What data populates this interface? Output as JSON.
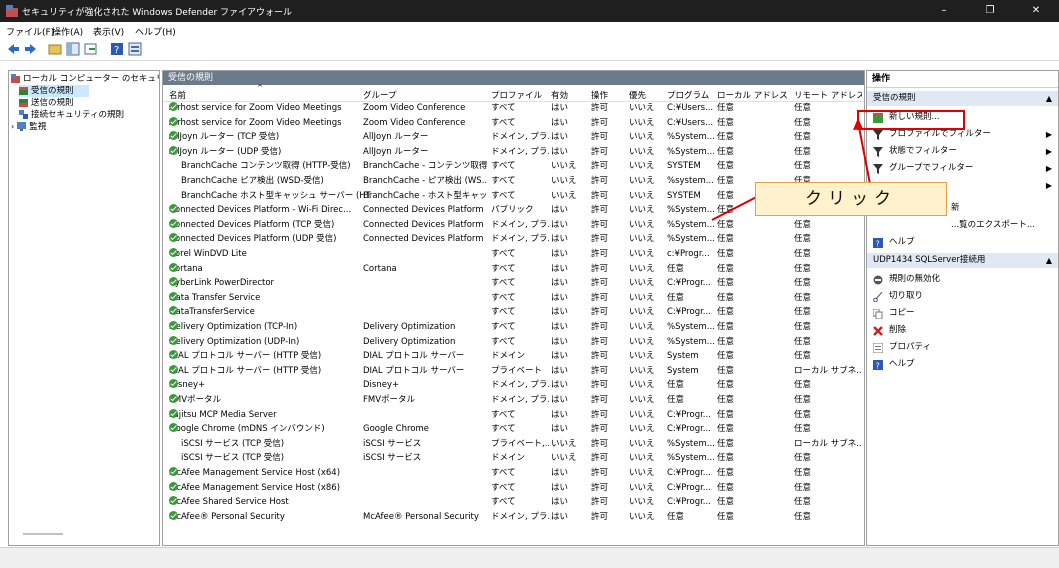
{
  "window": {
    "title": "セキュリティが強化された Windows Defender ファイアウォール",
    "min": "–",
    "restore": "❐",
    "close": "✕"
  },
  "menu": [
    "ファイル(F)",
    "操作(A)",
    "表示(V)",
    "ヘルプ(H)"
  ],
  "tree": {
    "root": "ローカル コンピューター のセキュリティ",
    "items": [
      "受信の規則",
      "送信の規則",
      "接続セキュリティの規則",
      "監視"
    ]
  },
  "middle": {
    "header": "受信の規則",
    "columns": [
      "名前",
      "グループ",
      "プロファイル",
      "有効",
      "操作",
      "優先",
      "プログラム",
      "ローカル アドレス",
      "リモート アドレス"
    ],
    "rows": [
      {
        "icon": true,
        "name": "Airhost service for Zoom Video Meetings",
        "group": "Zoom Video Conference",
        "profile": "すべて",
        "enabled": "はい",
        "action": "許可",
        "override": "いいえ",
        "program": "C:¥Users...",
        "local": "任意",
        "remote": "任意"
      },
      {
        "icon": true,
        "name": "Airhost service for Zoom Video Meetings",
        "group": "Zoom Video Conference",
        "profile": "すべて",
        "enabled": "はい",
        "action": "許可",
        "override": "いいえ",
        "program": "C:¥Users...",
        "local": "任意",
        "remote": "任意"
      },
      {
        "icon": true,
        "name": "AllJoyn ルーター (TCP 受信)",
        "group": "AllJoyn ルーター",
        "profile": "ドメイン, プラ...",
        "enabled": "はい",
        "action": "許可",
        "override": "いいえ",
        "program": "%System...",
        "local": "任意",
        "remote": "任意"
      },
      {
        "icon": true,
        "name": "AllJoyn ルーター (UDP 受信)",
        "group": "AllJoyn ルーター",
        "profile": "ドメイン, プラ...",
        "enabled": "はい",
        "action": "許可",
        "override": "いいえ",
        "program": "%System...",
        "local": "任意",
        "remote": "任意"
      },
      {
        "icon": false,
        "name": "BranchCache コンテンツ取得 (HTTP-受信)",
        "group": "BranchCache - コンテンツ取得...",
        "profile": "すべて",
        "enabled": "いいえ",
        "action": "許可",
        "override": "いいえ",
        "program": "SYSTEM",
        "local": "任意",
        "remote": "任意"
      },
      {
        "icon": false,
        "name": "BranchCache ピア検出 (WSD-受信)",
        "group": "BranchCache - ピア検出 (WS...",
        "profile": "すべて",
        "enabled": "いいえ",
        "action": "許可",
        "override": "いいえ",
        "program": "%system...",
        "local": "任意",
        "remote": "任意"
      },
      {
        "icon": false,
        "name": "BranchCache ホスト型キャッシュ サーバー (HT...",
        "group": "BranchCache - ホスト型キャッ...",
        "profile": "すべて",
        "enabled": "いいえ",
        "action": "許可",
        "override": "いいえ",
        "program": "SYSTEM",
        "local": "任意",
        "remote": "任意"
      },
      {
        "icon": true,
        "name": "Connected Devices Platform - Wi-Fi Direc...",
        "group": "Connected Devices Platform",
        "profile": "パブリック",
        "enabled": "はい",
        "action": "許可",
        "override": "いいえ",
        "program": "%System...",
        "local": "任意",
        "remote": "任意"
      },
      {
        "icon": true,
        "name": "Connected Devices Platform (TCP 受信)",
        "group": "Connected Devices Platform",
        "profile": "ドメイン, プラ...",
        "enabled": "はい",
        "action": "許可",
        "override": "いいえ",
        "program": "%System...",
        "local": "任意",
        "remote": "任意"
      },
      {
        "icon": true,
        "name": "Connected Devices Platform (UDP 受信)",
        "group": "Connected Devices Platform",
        "profile": "ドメイン, プラ...",
        "enabled": "はい",
        "action": "許可",
        "override": "いいえ",
        "program": "%System...",
        "local": "任意",
        "remote": "任意"
      },
      {
        "icon": true,
        "name": "Corel WinDVD Lite",
        "group": "",
        "profile": "すべて",
        "enabled": "はい",
        "action": "許可",
        "override": "いいえ",
        "program": "c:¥Progr...",
        "local": "任意",
        "remote": "任意"
      },
      {
        "icon": true,
        "name": "Cortana",
        "group": "Cortana",
        "profile": "すべて",
        "enabled": "はい",
        "action": "許可",
        "override": "いいえ",
        "program": "任意",
        "local": "任意",
        "remote": "任意"
      },
      {
        "icon": true,
        "name": "CyberLink PowerDirector",
        "group": "",
        "profile": "すべて",
        "enabled": "はい",
        "action": "許可",
        "override": "いいえ",
        "program": "C:¥Progr...",
        "local": "任意",
        "remote": "任意"
      },
      {
        "icon": true,
        "name": "Data Transfer Service",
        "group": "",
        "profile": "すべて",
        "enabled": "はい",
        "action": "許可",
        "override": "いいえ",
        "program": "任意",
        "local": "任意",
        "remote": "任意"
      },
      {
        "icon": true,
        "name": "DataTransferService",
        "group": "",
        "profile": "すべて",
        "enabled": "はい",
        "action": "許可",
        "override": "いいえ",
        "program": "C:¥Progr...",
        "local": "任意",
        "remote": "任意"
      },
      {
        "icon": true,
        "name": "Delivery Optimization (TCP-In)",
        "group": "Delivery Optimization",
        "profile": "すべて",
        "enabled": "はい",
        "action": "許可",
        "override": "いいえ",
        "program": "%System...",
        "local": "任意",
        "remote": "任意"
      },
      {
        "icon": true,
        "name": "Delivery Optimization (UDP-In)",
        "group": "Delivery Optimization",
        "profile": "すべて",
        "enabled": "はい",
        "action": "許可",
        "override": "いいえ",
        "program": "%System...",
        "local": "任意",
        "remote": "任意"
      },
      {
        "icon": true,
        "name": "DIAL プロトコル サーバー (HTTP 受信)",
        "group": "DIAL プロトコル サーバー",
        "profile": "ドメイン",
        "enabled": "はい",
        "action": "許可",
        "override": "いいえ",
        "program": "System",
        "local": "任意",
        "remote": "任意"
      },
      {
        "icon": true,
        "name": "DIAL プロトコル サーバー (HTTP 受信)",
        "group": "DIAL プロトコル サーバー",
        "profile": "プライベート",
        "enabled": "はい",
        "action": "許可",
        "override": "いいえ",
        "program": "System",
        "local": "任意",
        "remote": "ローカル サブネ..."
      },
      {
        "icon": true,
        "name": "Disney+",
        "group": "Disney+",
        "profile": "ドメイン, プラ...",
        "enabled": "はい",
        "action": "許可",
        "override": "いいえ",
        "program": "任意",
        "local": "任意",
        "remote": "任意"
      },
      {
        "icon": true,
        "name": "FMVポータル",
        "group": "FMVポータル",
        "profile": "ドメイン, プラ...",
        "enabled": "はい",
        "action": "許可",
        "override": "いいえ",
        "program": "任意",
        "local": "任意",
        "remote": "任意"
      },
      {
        "icon": true,
        "name": "Fujitsu MCP Media Server",
        "group": "",
        "profile": "すべて",
        "enabled": "はい",
        "action": "許可",
        "override": "いいえ",
        "program": "C:¥Progr...",
        "local": "任意",
        "remote": "任意"
      },
      {
        "icon": true,
        "name": "Google Chrome (mDNS インバウンド)",
        "group": "Google Chrome",
        "profile": "すべて",
        "enabled": "はい",
        "action": "許可",
        "override": "いいえ",
        "program": "C:¥Progr...",
        "local": "任意",
        "remote": "任意"
      },
      {
        "icon": false,
        "name": "iSCSI サービス (TCP 受信)",
        "group": "iSCSI サービス",
        "profile": "プライベート,...",
        "enabled": "いいえ",
        "action": "許可",
        "override": "いいえ",
        "program": "%System...",
        "local": "任意",
        "remote": "ローカル サブネ..."
      },
      {
        "icon": false,
        "name": "iSCSI サービス (TCP 受信)",
        "group": "iSCSI サービス",
        "profile": "ドメイン",
        "enabled": "いいえ",
        "action": "許可",
        "override": "いいえ",
        "program": "%System...",
        "local": "任意",
        "remote": "任意"
      },
      {
        "icon": true,
        "name": "McAfee Management Service Host (x64)",
        "group": "",
        "profile": "すべて",
        "enabled": "はい",
        "action": "許可",
        "override": "いいえ",
        "program": "C:¥Progr...",
        "local": "任意",
        "remote": "任意"
      },
      {
        "icon": true,
        "name": "McAfee Management Service Host (x86)",
        "group": "",
        "profile": "すべて",
        "enabled": "はい",
        "action": "許可",
        "override": "いいえ",
        "program": "C:¥Progr...",
        "local": "任意",
        "remote": "任意"
      },
      {
        "icon": true,
        "name": "McAfee Shared Service Host",
        "group": "",
        "profile": "すべて",
        "enabled": "はい",
        "action": "許可",
        "override": "いいえ",
        "program": "C:¥Progr...",
        "local": "任意",
        "remote": "任意"
      },
      {
        "icon": true,
        "name": "McAfee® Personal Security",
        "group": "McAfee® Personal Security",
        "profile": "ドメイン, プラ...",
        "enabled": "はい",
        "action": "許可",
        "override": "いいえ",
        "program": "任意",
        "local": "任意",
        "remote": "任意"
      }
    ]
  },
  "actions": {
    "header": "操作",
    "section1": "受信の規則",
    "items1": [
      "新しい規則...",
      "プロファイルでフィルター",
      "状態でフィルター",
      "グループでフィルター",
      "",
      "新",
      "...覧のエクスポート...",
      "ヘルプ"
    ],
    "section2": "UDP1434 SQLServer接続用",
    "items2": [
      "規則の無効化",
      "切り取り",
      "コピー",
      "削除",
      "プロパティ",
      "ヘルプ"
    ]
  },
  "callout": "クリック",
  "colors": {
    "accent_red": "#e00000",
    "callout_bg": "#fff2cc",
    "check_green": "#3a9a3a"
  }
}
